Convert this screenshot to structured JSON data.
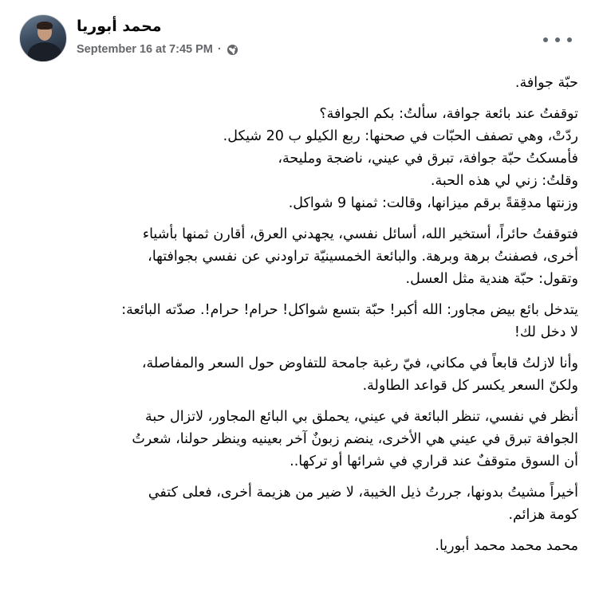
{
  "post": {
    "author": "محمد أبوريا",
    "timestamp": "September 16 at 7:45 PM",
    "separator": "·",
    "privacy_icon": "globe-icon",
    "more_icon": "more-horizontal-icon"
  },
  "body": {
    "p1": [
      "حبّة جوافة."
    ],
    "p2": [
      "توقفتُ عند بائعة جوافة، سألتُ: بكم الجوافة؟",
      "ردّتْ، وهي تصفف الحبّات في صحنها: ربع الكيلو ب 20 شيكل.",
      "فأمسكتُ حبّة جوافة، تبرق في عيني، ناضجة ومليحة،",
      "وقلتُ: زني لي هذه الحبة.",
      "وزنتها مدقِقةً برقم ميزانها، وقالت: ثمنها 9 شواكل."
    ],
    "p3": [
      "فتوقفتُ حائراً، أستخير الله، أسائل نفسي، يجهدني العرق، أقارن ثمنها بأشياء",
      "أخرى، فصفنتُ برهة وبرهة. والبائعة الخمسينيّة تراودني عن نفسي بجوافتها،",
      "وتقول: حبّة هندية مثل العسل."
    ],
    "p4": [
      "يتدخل بائع بيض مجاور: الله أكبر! حبّة بتسع شواكل! حرام! حرام!. صدّته البائعة:",
      "لا دخل لك!"
    ],
    "p5": [
      "وأنا لازلتُ قابعاً في مكاني، فيّ رغبة جامحة للتفاوض حول السعر والمفاصلة،",
      "ولكنّ السعر يكسر كل قواعد الطاولة."
    ],
    "p6": [
      "أنظر في نفسي، تنظر البائعة في عيني، يحملق بي البائع المجاور، لاتزال حبة",
      "الجوافة تبرق في عيني هي الأخرى، ينضم زبونٌ آخر بعينيه وينظر حولنا، شعرتُ",
      "أن السوق متوقفٌ عند قراري في شرائها أو تركها.."
    ],
    "p7": [
      "أخيراً مشيتُ بدونها، جررتُ ذيل الخيبة، لا ضير من هزيمة أخرى، فعلى كتفي",
      "كومة هزائم."
    ],
    "p8": [
      "محمد محمد محمد أبوريا."
    ]
  }
}
